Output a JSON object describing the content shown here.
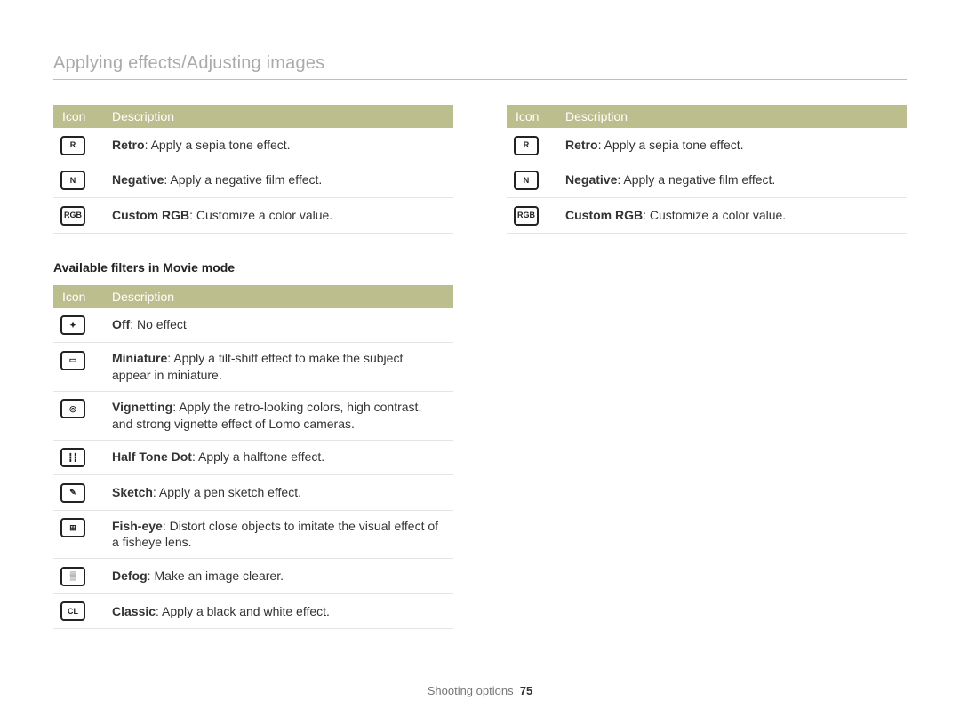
{
  "page_title": "Applying effects/Adjusting images",
  "table_headers": {
    "icon": "Icon",
    "desc": "Description"
  },
  "table_left_top": [
    {
      "icon": "R",
      "term": "Retro",
      "rest": ": Apply a sepia tone effect."
    },
    {
      "icon": "N",
      "term": "Negative",
      "rest": ": Apply a negative film effect."
    },
    {
      "icon": "RGB",
      "term": "Custom RGB",
      "rest": ": Customize a color value."
    }
  ],
  "subheading": "Available filters in Movie mode",
  "table_left_bottom": [
    {
      "icon": "✦",
      "term": "Off",
      "rest": ": No effect"
    },
    {
      "icon": "▭",
      "term": "Miniature",
      "rest": ": Apply a tilt-shift effect to make the subject appear in miniature."
    },
    {
      "icon": "◎",
      "term": "Vignetting",
      "rest": ": Apply the retro-looking colors, high contrast, and strong vignette effect of Lomo cameras."
    },
    {
      "icon": "┇┇",
      "term": "Half Tone Dot",
      "rest": ": Apply a halftone effect."
    },
    {
      "icon": "✎",
      "term": "Sketch",
      "rest": ": Apply a pen sketch effect."
    },
    {
      "icon": "⊞",
      "term": "Fish-eye",
      "rest": ": Distort close objects to imitate the visual effect of a fisheye lens."
    },
    {
      "icon": "▒",
      "term": "Defog",
      "rest": ": Make an image clearer."
    },
    {
      "icon": "CL",
      "term": "Classic",
      "rest": ": Apply a black and white effect."
    }
  ],
  "table_right_top": [
    {
      "icon": "R",
      "term": "Retro",
      "rest": ": Apply a sepia tone effect."
    },
    {
      "icon": "N",
      "term": "Negative",
      "rest": ": Apply a negative film effect."
    },
    {
      "icon": "RGB",
      "term": "Custom RGB",
      "rest": ": Customize a color value."
    }
  ],
  "footer_label": "Shooting options",
  "page_number": "75"
}
